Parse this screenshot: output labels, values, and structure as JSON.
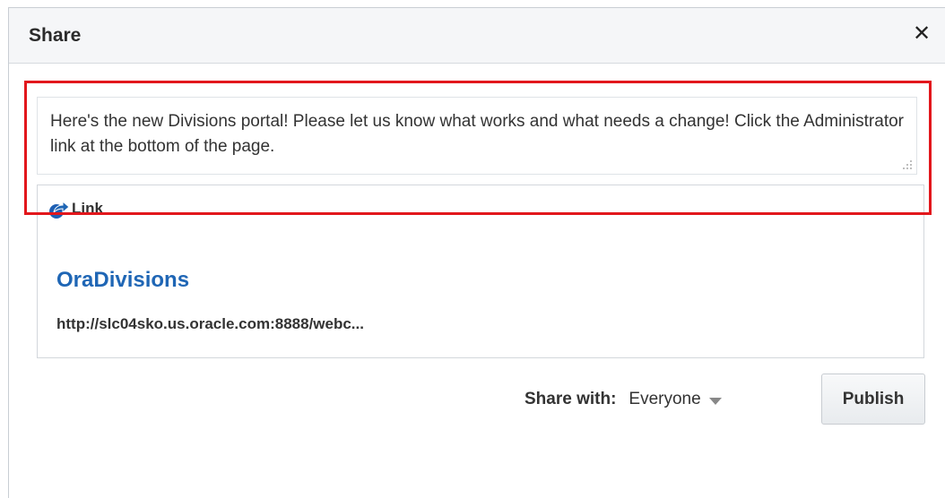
{
  "dialog": {
    "title": "Share",
    "close_glyph": "✕"
  },
  "message": {
    "text": "Here's the new Divisions portal! Please let us know what works and what needs a change! Click the Administrator link at the bottom of the page."
  },
  "link": {
    "icon": "share-link-icon",
    "label": "Link",
    "title": "OraDivisions",
    "url": "http://slc04sko.us.oracle.com:8888/webc..."
  },
  "share": {
    "label": "Share with:",
    "selected": "Everyone"
  },
  "actions": {
    "publish_label": "Publish"
  },
  "colors": {
    "accent_link": "#1f66b5",
    "highlight": "#e2171c"
  }
}
